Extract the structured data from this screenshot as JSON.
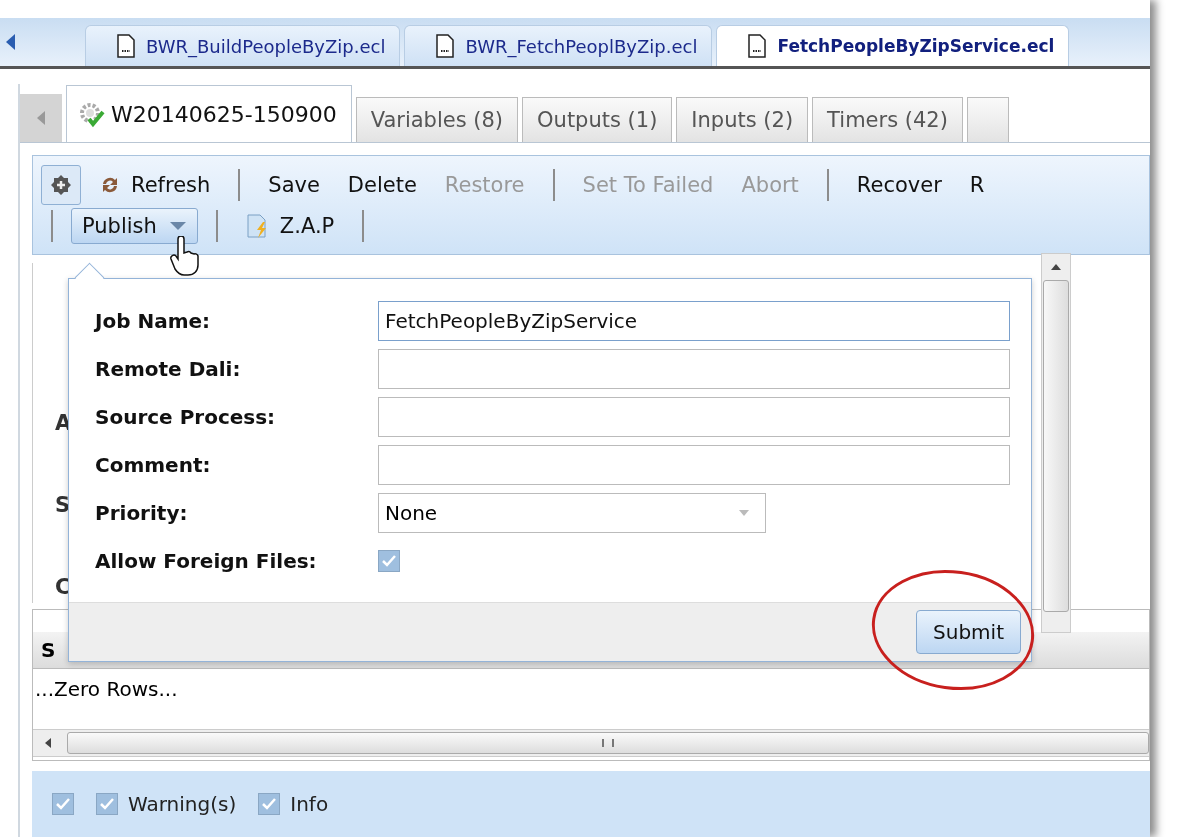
{
  "file_tabs": [
    {
      "label": "BWR_BuildPeopleByZip.ecl",
      "selected": false
    },
    {
      "label": "BWR_FetchPeoplByZip.ecl",
      "selected": false
    },
    {
      "label": "FetchPeopleByZipService.ecl",
      "selected": true
    }
  ],
  "workunit_tabs": [
    {
      "label": "W20140625-150900",
      "kind": "workunit",
      "selected": true
    },
    {
      "label": "Variables (8)",
      "kind": "tab",
      "selected": false
    },
    {
      "label": "Outputs (1)",
      "kind": "tab",
      "selected": false
    },
    {
      "label": "Inputs (2)",
      "kind": "tab",
      "selected": false
    },
    {
      "label": "Timers (42)",
      "kind": "tab",
      "selected": false
    }
  ],
  "toolbar_rows": [
    [
      {
        "kind": "gear"
      },
      {
        "kind": "refresh",
        "label": "Refresh",
        "disabled": false
      },
      {
        "kind": "separator"
      },
      {
        "kind": "button",
        "label": "Save",
        "disabled": false
      },
      {
        "kind": "button",
        "label": "Delete",
        "disabled": false
      },
      {
        "kind": "button",
        "label": "Restore",
        "disabled": true
      },
      {
        "kind": "separator"
      },
      {
        "kind": "button",
        "label": "Set To Failed",
        "disabled": true
      },
      {
        "kind": "button",
        "label": "Abort",
        "disabled": true
      },
      {
        "kind": "separator"
      },
      {
        "kind": "button",
        "label": "Recover",
        "disabled": false
      },
      {
        "kind": "button",
        "label": "R",
        "disabled": false
      }
    ],
    [
      {
        "kind": "separator"
      },
      {
        "kind": "dropdown",
        "label": "Publish",
        "disabled": false
      },
      {
        "kind": "separator"
      },
      {
        "kind": "zap",
        "label": "Z.A.P",
        "disabled": false
      },
      {
        "kind": "separator"
      }
    ]
  ],
  "background_labels": [
    "A",
    "S",
    "C"
  ],
  "publish_popup": {
    "fields": [
      {
        "label": "Job Name:",
        "kind": "text",
        "value": "FetchPeopleByZipService"
      },
      {
        "label": "Remote Dali:",
        "kind": "text"
      },
      {
        "label": "Source Process:",
        "kind": "text"
      },
      {
        "label": "Comment:",
        "kind": "text"
      },
      {
        "label": "Priority:",
        "kind": "select",
        "value": "None"
      },
      {
        "label": "Allow Foreign Files:",
        "kind": "checkbox",
        "checked": true
      }
    ],
    "submit": "Submit"
  },
  "table": {
    "column_1": "S",
    "empty_message": "...Zero Rows..."
  },
  "filters": [
    {
      "checked": true
    },
    {
      "label": "Warning(s)",
      "checked": true
    },
    {
      "label": "Info",
      "checked": true
    }
  ]
}
